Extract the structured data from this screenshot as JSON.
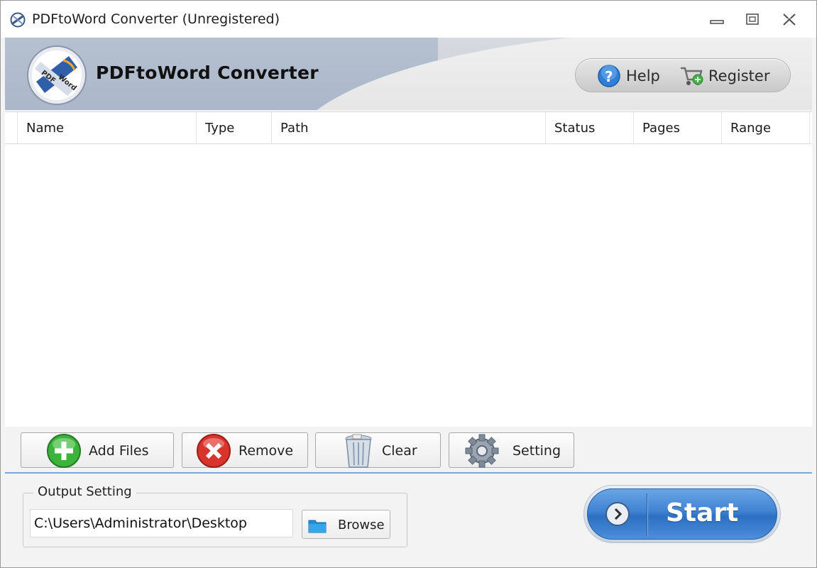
{
  "window": {
    "title": "PDFtoWord Converter (Unregistered)"
  },
  "header": {
    "app_title": "PDFtoWord Converter",
    "help_label": "Help",
    "register_label": "Register"
  },
  "file_list": {
    "columns": [
      "Name",
      "Type",
      "Path",
      "Status",
      "Pages",
      "Range"
    ],
    "rows": []
  },
  "actions": {
    "add_files_label": "Add Files",
    "remove_label": "Remove",
    "clear_label": "Clear",
    "setting_label": "Setting"
  },
  "output": {
    "legend": "Output Setting",
    "path_value": "C:\\Users\\Administrator\\Desktop",
    "browse_label": "Browse"
  },
  "start": {
    "label": "Start"
  },
  "icons": {
    "app": "pdf-to-word-logo-icon",
    "help": "question-circle-icon",
    "register": "cart-add-icon",
    "add": "plus-circle-icon",
    "remove": "x-circle-icon",
    "clear": "trash-icon",
    "setting": "gear-icon",
    "browse": "folder-icon",
    "start": "chevron-right-circle-icon"
  },
  "colors": {
    "accent": "#3f82d2",
    "separator": "#7fa7d6",
    "add_green": "#3cb43c",
    "remove_red": "#d9342b"
  }
}
